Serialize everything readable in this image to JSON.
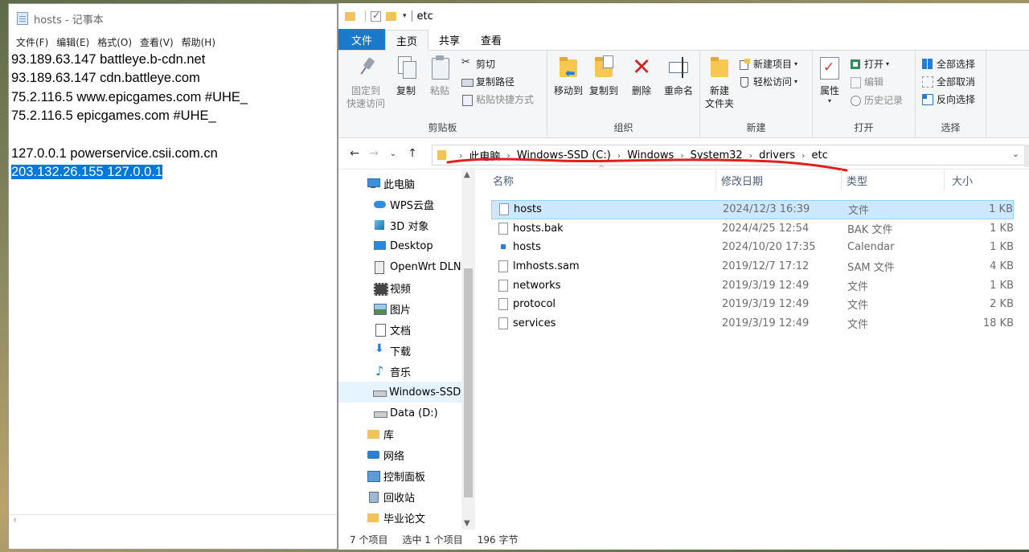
{
  "notepad": {
    "title": "hosts - 记事本",
    "menu": [
      "文件(F)",
      "编辑(E)",
      "格式(O)",
      "查看(V)",
      "帮助(H)"
    ],
    "lines": [
      "93.189.63.147 battleye.b-cdn.net",
      "93.189.63.147 cdn.battleye.com",
      "75.2.116.5 www.epicgames.com #UHE_",
      "75.2.116.5 epicgames.com #UHE_",
      "",
      "127.0.0.1 powerservice.csii.com.cn",
      "203.132.26.155 127.0.0.1"
    ],
    "selected_line_index": 6
  },
  "explorer": {
    "title": "etc",
    "tabs": {
      "file": "文件",
      "home": "主页",
      "share": "共享",
      "view": "查看"
    },
    "ribbon": {
      "clipboard": {
        "label": "剪贴板",
        "pin": "固定到\n快速访问",
        "copy": "复制",
        "paste": "粘贴",
        "cut": "剪切",
        "copy_path": "复制路径",
        "paste_shortcut": "粘贴快捷方式"
      },
      "organize": {
        "label": "组织",
        "move_to": "移动到",
        "copy_to": "复制到",
        "delete": "删除",
        "rename": "重命名"
      },
      "new": {
        "label": "新建",
        "new_folder": "新建\n文件夹",
        "new_item": "新建项目",
        "easy_access": "轻松访问"
      },
      "open": {
        "label": "打开",
        "properties": "属性",
        "open": "打开",
        "edit": "编辑",
        "history": "历史记录"
      },
      "select": {
        "label": "选择",
        "select_all": "全部选择",
        "select_none": "全部取消",
        "invert": "反向选择"
      }
    },
    "breadcrumb": [
      "此电脑",
      "Windows-SSD (C:)",
      "Windows",
      "System32",
      "drivers",
      "etc"
    ],
    "nav": [
      {
        "label": "此电脑",
        "icon": "pc-icon",
        "level": 0
      },
      {
        "label": "WPS云盘",
        "icon": "cloud-icon",
        "level": 1
      },
      {
        "label": "3D 对象",
        "icon": "3d-objects-icon",
        "level": 1
      },
      {
        "label": "Desktop",
        "icon": "desktop-icon",
        "level": 1
      },
      {
        "label": "OpenWrt DLN",
        "icon": "media-server-icon",
        "level": 1
      },
      {
        "label": "视频",
        "icon": "video-icon",
        "level": 1
      },
      {
        "label": "图片",
        "icon": "pictures-icon",
        "level": 1
      },
      {
        "label": "文档",
        "icon": "documents-icon",
        "level": 1
      },
      {
        "label": "下载",
        "icon": "download-icon",
        "level": 1
      },
      {
        "label": "音乐",
        "icon": "music-icon",
        "level": 1
      },
      {
        "label": "Windows-SSD",
        "icon": "drive-icon",
        "level": 1,
        "selected": true
      },
      {
        "label": "Data (D:)",
        "icon": "drive-icon",
        "level": 1
      },
      {
        "label": "库",
        "icon": "library-icon",
        "level": 0
      },
      {
        "label": "网络",
        "icon": "network-icon",
        "level": 0
      },
      {
        "label": "控制面板",
        "icon": "control-panel-icon",
        "level": 0
      },
      {
        "label": "回收站",
        "icon": "recycle-bin-icon",
        "level": 0
      },
      {
        "label": "毕业论文",
        "icon": "folder-icon",
        "level": 0
      }
    ],
    "columns": {
      "name": "名称",
      "date": "修改日期",
      "type": "类型",
      "size": "大小"
    },
    "files": [
      {
        "name": "hosts",
        "date": "2024/12/3 16:39",
        "type": "文件",
        "size": "1 KB",
        "icon": "file-icon",
        "selected": true
      },
      {
        "name": "hosts.bak",
        "date": "2024/4/25 12:54",
        "type": "BAK 文件",
        "size": "1 KB",
        "icon": "file-icon"
      },
      {
        "name": "hosts",
        "date": "2024/10/20 17:35",
        "type": "Calendar",
        "size": "1 KB",
        "icon": "calendar-file-icon"
      },
      {
        "name": "lmhosts.sam",
        "date": "2019/12/7 17:12",
        "type": "SAM 文件",
        "size": "4 KB",
        "icon": "file-icon"
      },
      {
        "name": "networks",
        "date": "2019/3/19 12:49",
        "type": "文件",
        "size": "1 KB",
        "icon": "file-icon"
      },
      {
        "name": "protocol",
        "date": "2019/3/19 12:49",
        "type": "文件",
        "size": "2 KB",
        "icon": "file-icon"
      },
      {
        "name": "services",
        "date": "2019/3/19 12:49",
        "type": "文件",
        "size": "18 KB",
        "icon": "file-icon"
      }
    ],
    "status": {
      "count": "7 个项目",
      "selected": "选中 1 个项目",
      "size": "196 字节"
    },
    "colors": {
      "accent": "#1979ca",
      "selection": "#cce8ff",
      "annotation": "#e02020"
    }
  }
}
